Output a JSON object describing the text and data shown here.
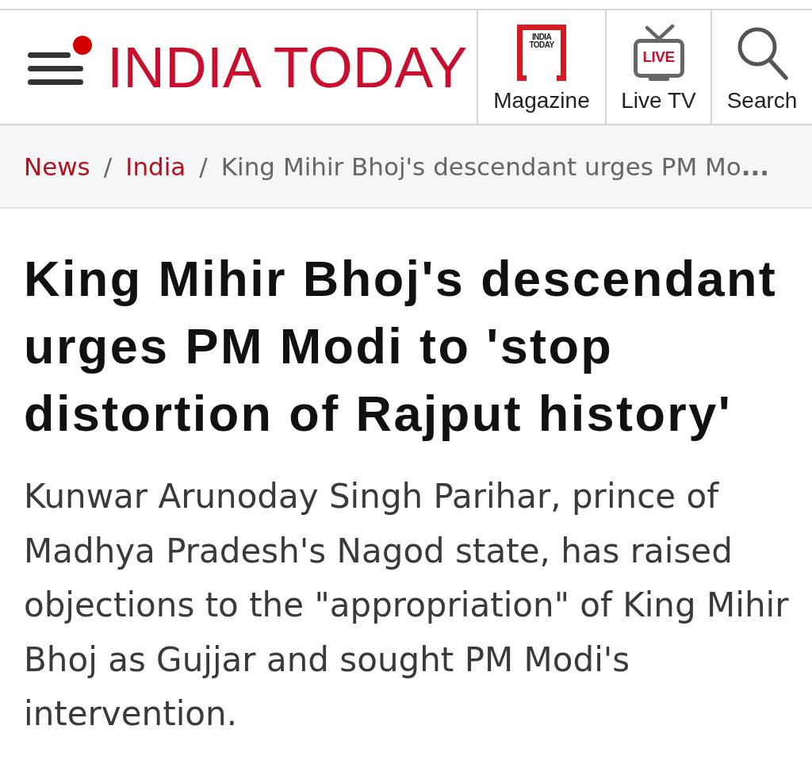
{
  "header": {
    "logo": "INDIA TODAY",
    "nav": [
      {
        "kind": "magazine",
        "label": "Magazine",
        "icon_text": "INDIA TODAY"
      },
      {
        "kind": "live_tv",
        "label": "Live TV",
        "icon_text": "LIVE"
      },
      {
        "kind": "search",
        "label": "Search"
      }
    ]
  },
  "breadcrumb": [
    {
      "kind": "link",
      "label": "News"
    },
    {
      "kind": "separator",
      "label": "/"
    },
    {
      "kind": "link",
      "label": "India"
    },
    {
      "kind": "separator",
      "label": "/"
    },
    {
      "kind": "current",
      "label": "King Mihir Bhoj's descendant urges PM Mo**...**"
    }
  ],
  "article": {
    "headline": "King Mihir Bhoj's descendant urges PM Modi to 'stop distortion of Rajput history'",
    "summary": "Kunwar Arunoday Singh Parihar, prince of Madhya Pradesh's Nagod state, has raised objections to the \"appropriation\" of King Mihir Bhoj as Gujjar and sought PM Modi's intervention."
  }
}
